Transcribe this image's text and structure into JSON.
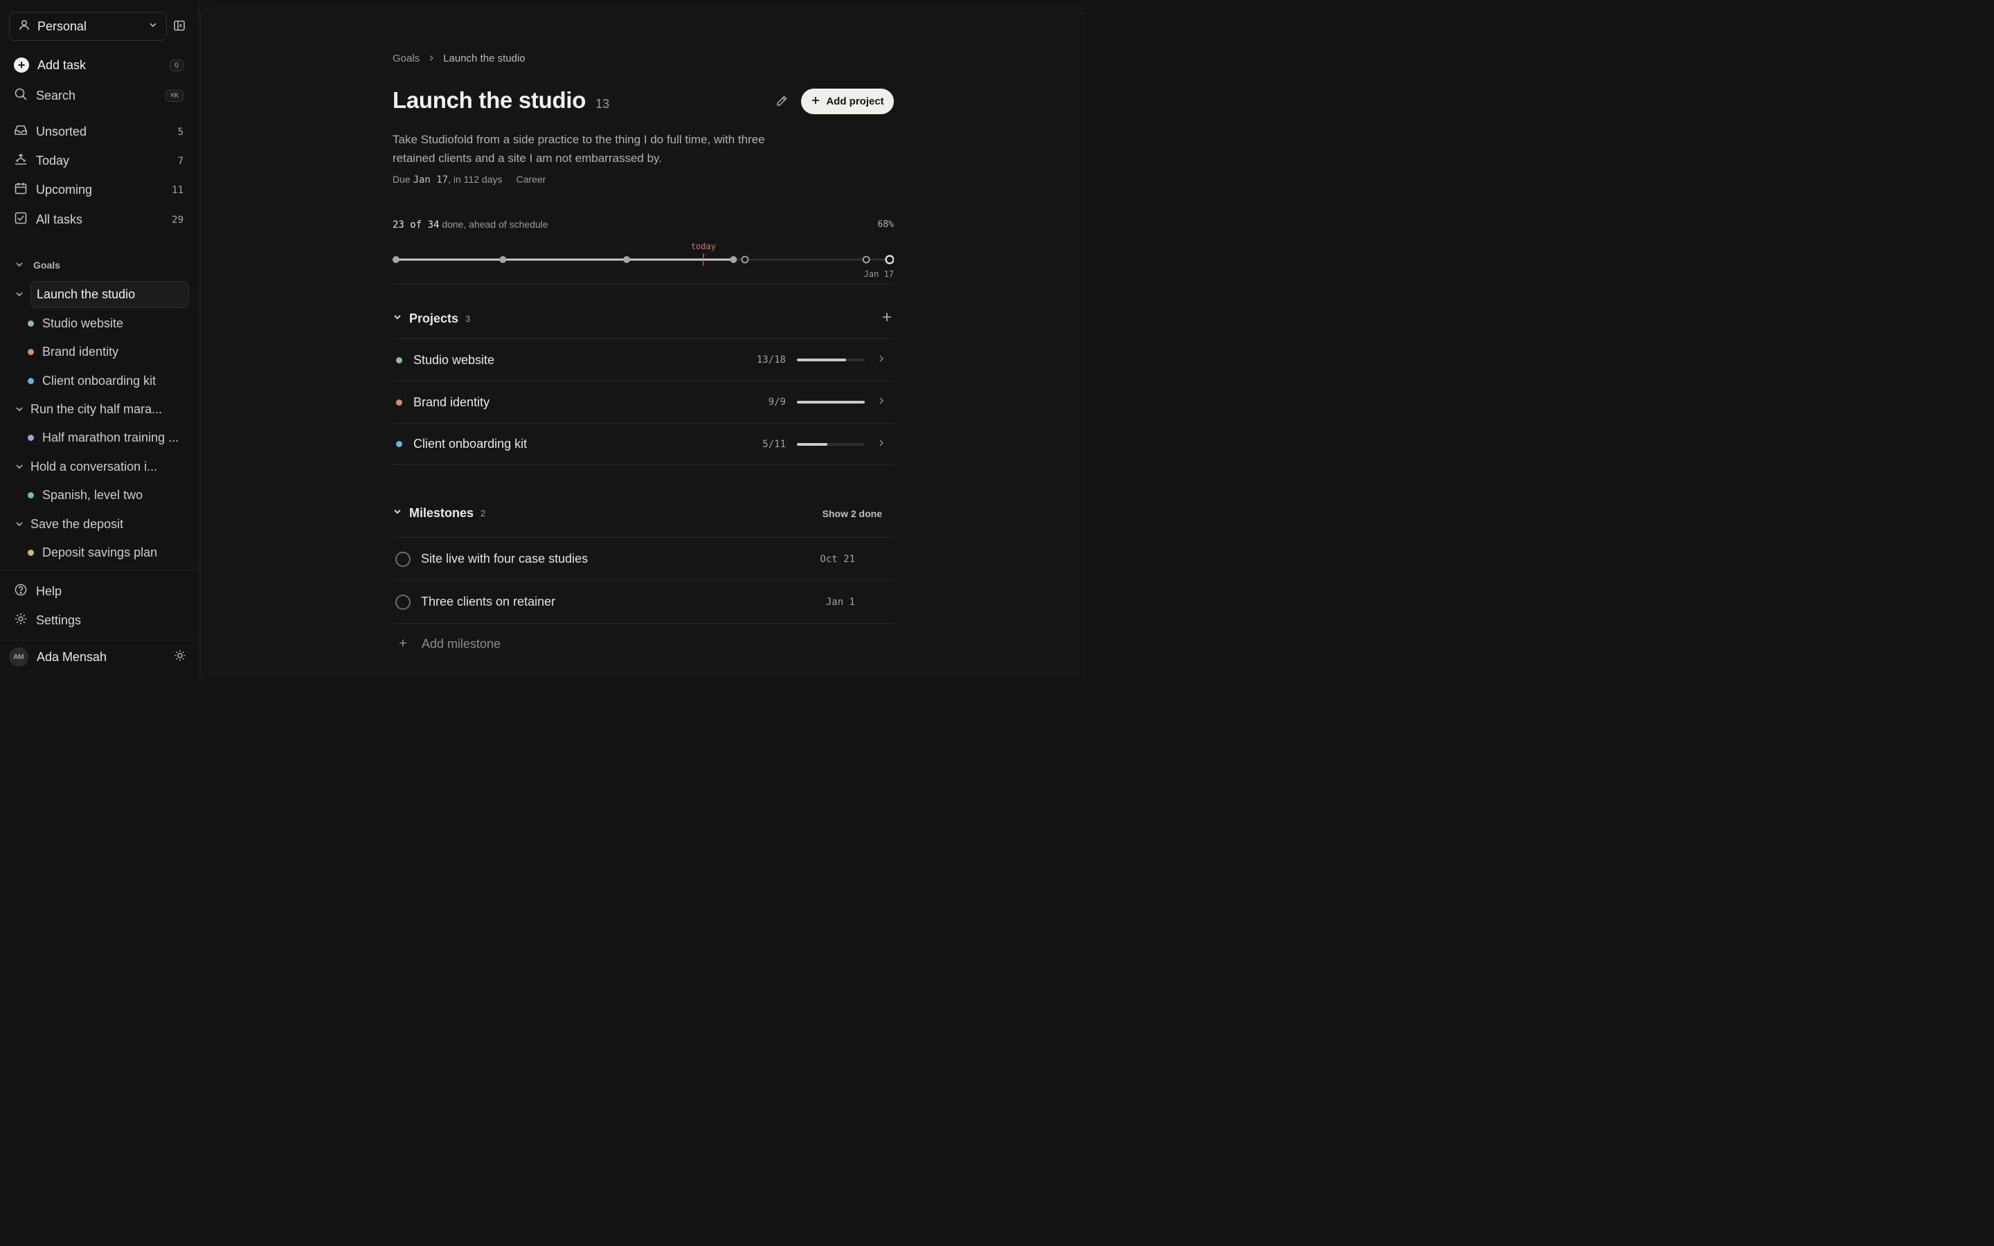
{
  "sidebar": {
    "workspace": "Personal",
    "add_task": {
      "label": "Add task",
      "shortcut": "Q"
    },
    "search": {
      "label": "Search",
      "shortcut": "⌘K"
    },
    "nav": [
      {
        "label": "Unsorted",
        "count": "5",
        "icon": "inbox-icon"
      },
      {
        "label": "Today",
        "count": "7",
        "icon": "sunrise-icon"
      },
      {
        "label": "Upcoming",
        "count": "11",
        "icon": "calendar-icon"
      },
      {
        "label": "All tasks",
        "count": "29",
        "icon": "checkbox-icon"
      }
    ],
    "goals_heading": "Goals",
    "goals": [
      {
        "label": "Launch the studio",
        "active": true,
        "projects": [
          {
            "label": "Studio website",
            "color": "#8fbf8a"
          },
          {
            "label": "Brand identity",
            "color": "#d08f74"
          },
          {
            "label": "Client onboarding kit",
            "color": "#6db0d6"
          }
        ]
      },
      {
        "label": "Run the city half mara...",
        "projects": [
          {
            "label": "Half marathon training ...",
            "color": "#b79bd8"
          }
        ]
      },
      {
        "label": "Hold a conversation i...",
        "projects": [
          {
            "label": "Spanish, level two",
            "color": "#6fb9c9"
          }
        ]
      },
      {
        "label": "Save the deposit",
        "projects": [
          {
            "label": "Deposit savings plan",
            "color": "#c9b97a"
          }
        ]
      }
    ],
    "help": "Help",
    "settings": "Settings",
    "user": {
      "initials": "AM",
      "name": "Ada Mensah"
    }
  },
  "main": {
    "breadcrumb": {
      "root": "Goals",
      "current": "Launch the studio"
    },
    "title": "Launch the studio",
    "title_count": "13",
    "add_project": "Add project",
    "description": "Take Studiofold from a side practice to the thing I do full time, with three retained clients and a site I am not embarrassed by.",
    "meta": {
      "due_prefix": "Due",
      "due_date": "Jan 17",
      "due_rel": ", in 112 days",
      "tag": "Career"
    },
    "progress": {
      "done_text": "23 of 34",
      "status_text": " done, ahead of schedule",
      "percent": "68%",
      "fraction": 0.68,
      "today_label": "today",
      "today_fraction": 0.62,
      "end_label": "Jan 17",
      "markers_done": [
        0,
        0.22,
        0.467,
        0.68
      ],
      "markers_open": [
        0.703,
        0.945,
        1.0
      ]
    },
    "projects": {
      "heading": "Projects",
      "count": "3",
      "items": [
        {
          "label": "Studio website",
          "count": "13/18",
          "progress": 0.72,
          "color": "#8fbf8a"
        },
        {
          "label": "Brand identity",
          "count": "9/9",
          "progress": 1.0,
          "color": "#d08f74"
        },
        {
          "label": "Client onboarding kit",
          "count": "5/11",
          "progress": 0.45,
          "color": "#6db0d6"
        }
      ]
    },
    "milestones": {
      "heading": "Milestones",
      "count": "2",
      "show_done": "Show 2 done",
      "items": [
        {
          "label": "Site live with four case studies",
          "date": "Oct 21"
        },
        {
          "label": "Three clients on retainer",
          "date": "Jan 1"
        }
      ],
      "add_label": "Add milestone"
    }
  }
}
